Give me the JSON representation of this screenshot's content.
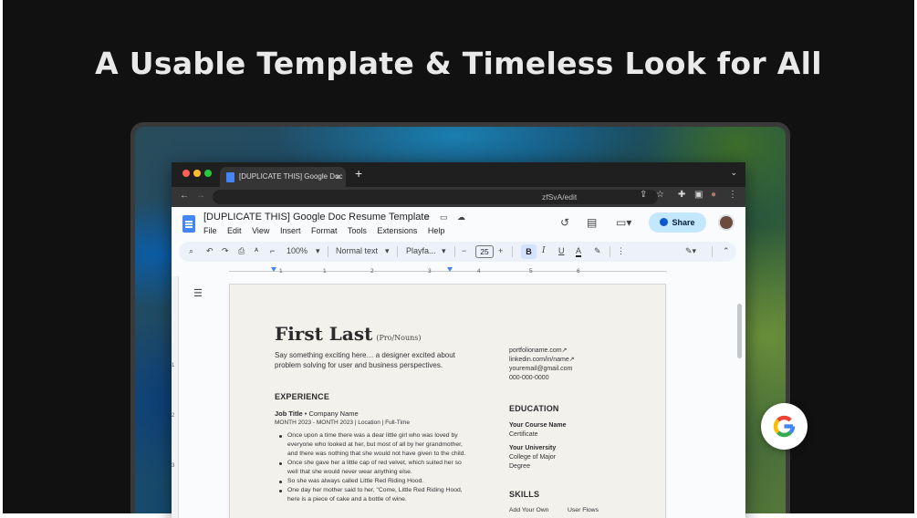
{
  "headline": "A Usable Template & Timeless Look for All",
  "colors": {
    "background": "#111111",
    "accent": "#4285f4",
    "share_bg": "#c2e7ff",
    "traffic_red": "#ff5f57",
    "traffic_yellow": "#febc2e",
    "traffic_green": "#28c840"
  },
  "browser": {
    "tab_title": "[DUPLICATE THIS] Google Doc",
    "tab_close": "×",
    "new_tab": "+",
    "tab_dropdown": "⌄",
    "back": "←",
    "forward": "→",
    "url": "zfSvA/edit",
    "icons": [
      "share-icon",
      "star-icon",
      "extensions-icon",
      "sidepanel-icon",
      "profile-icon",
      "kebab-icon"
    ]
  },
  "docs": {
    "title": "[DUPLICATE THIS] Google Doc Resume Template",
    "menus": [
      "File",
      "Edit",
      "View",
      "Insert",
      "Format",
      "Tools",
      "Extensions",
      "Help"
    ],
    "share_label": "Share",
    "toolbar": {
      "zoom": "100%",
      "style": "Normal text",
      "font": "Playfa...",
      "font_size": "25",
      "minus": "−",
      "plus": "+",
      "bold": "B",
      "italic": "I",
      "underline": "U",
      "text_color": "A"
    },
    "ruler_ticks": [
      "1",
      "1",
      "2",
      "3",
      "4",
      "5",
      "6"
    ],
    "vruler_ticks": [
      "1",
      "2",
      "3"
    ]
  },
  "resume": {
    "name": "First Last",
    "pronouns": "(Pro/Nouns)",
    "intro": "Say something exciting here… a designer excited about problem solving for user and business perspectives.",
    "contact": [
      "portfolioname.com↗",
      "linkedin.com/in/name↗",
      "youremail@gmail.com",
      "000-000-0000"
    ],
    "experience_heading": "EXPERIENCE",
    "job_title": "Job Title",
    "job_company": " • Company Name",
    "job_meta": "MONTH 2023 - MONTH 2023 | Location | Full-Time",
    "bullets": [
      "Once upon a time there was a dear little girl who was loved by everyone who looked at her, but most of all by her grandmother, and there was nothing that she would not have given to the child.",
      "Once she gave her a little cap of red velvet, which suited her so well that she would never wear anything else.",
      "So she was always called Little Red Riding Hood.",
      "One day her mother said to her, \"Come, Little Red Riding Hood, here is a piece of cake and a bottle of wine."
    ],
    "education_heading": "EDUCATION",
    "course_name": "Your Course Name",
    "course_type": "Certificate",
    "university": "Your University",
    "college": "College of Major",
    "degree": "Degree",
    "skills_heading": "SKILLS",
    "skills": [
      "Add Your Own",
      "User Flows"
    ]
  }
}
